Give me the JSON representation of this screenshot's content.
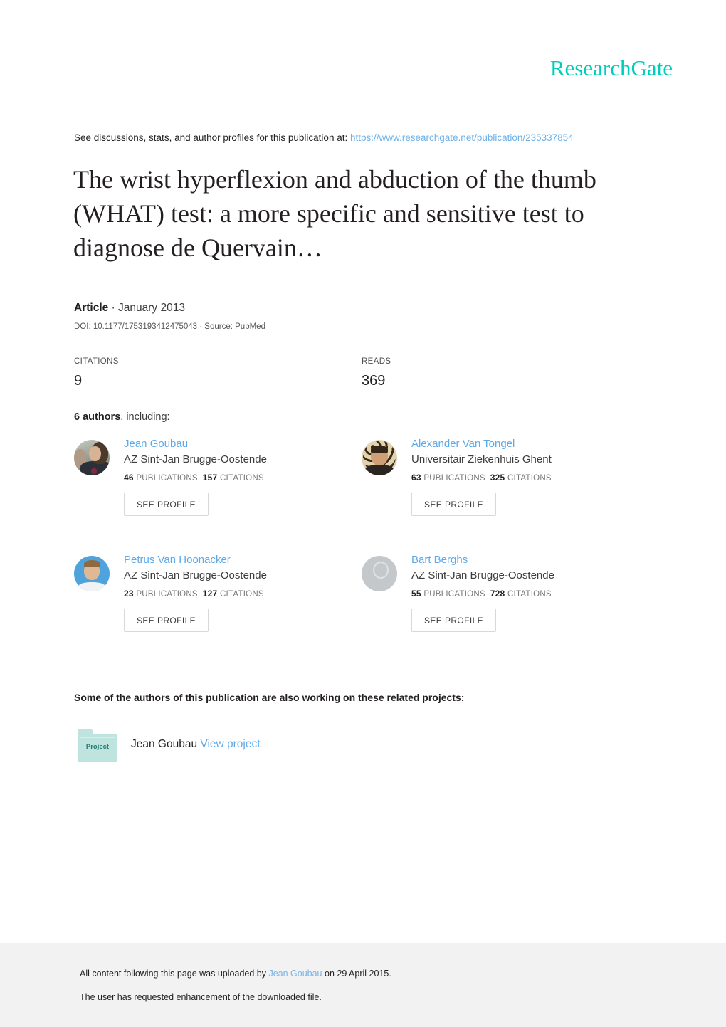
{
  "brand": {
    "logo_text": "ResearchGate",
    "logo_color": "#00CCBB"
  },
  "discussion": {
    "prefix": "See discussions, stats, and author profiles for this publication at:",
    "url": "https://www.researchgate.net/publication/235337854",
    "url_color": "#6EB1E8"
  },
  "publication": {
    "title": "The wrist hyperflexion and abduction of the thumb (WHAT) test: a more specific and sensitive test to diagnose de Quervain…",
    "type": "Article",
    "type_separator": " · ",
    "date": "January 2013",
    "doi_line": "DOI: 10.1177/1753193412475043 · Source: PubMed"
  },
  "stats": {
    "citations": {
      "label": "CITATIONS",
      "value": "9"
    },
    "reads": {
      "label": "READS",
      "value": "369"
    }
  },
  "authors_section": {
    "count_text": "6 authors",
    "suffix_text": ", including:",
    "see_profile_label": "SEE PROFILE",
    "publications_label": "PUBLICATIONS",
    "citations_label": "CITATIONS",
    "authors": [
      {
        "name": "Jean Goubau",
        "institution": "AZ Sint-Jan Brugge-Oostende",
        "publications": "46",
        "citations": "157",
        "avatar": "photo-portrait-male-glasses"
      },
      {
        "name": "Alexander Van Tongel",
        "institution": "Universitair Ziekenhuis Ghent",
        "publications": "63",
        "citations": "325",
        "avatar": "photo-portrait-male-glasses"
      },
      {
        "name": "Petrus Van Hoonacker",
        "institution": "AZ Sint-Jan Brugge-Oostende",
        "publications": "23",
        "citations": "127",
        "avatar": "photo-portrait-male-blue-bg"
      },
      {
        "name": "Bart Berghs",
        "institution": "AZ Sint-Jan Brugge-Oostende",
        "publications": "55",
        "citations": "728",
        "avatar": "placeholder-person-icon"
      }
    ]
  },
  "projects": {
    "heading": "Some of the authors of this publication are also working on these related projects:",
    "folder_label": "Project",
    "owner": "Jean Goubau ",
    "link_label": "View project"
  },
  "footer": {
    "upload_prefix": "All content following this page was uploaded by ",
    "uploader": "Jean Goubau",
    "upload_suffix": " on 29 April 2015.",
    "enhancement_note": "The user has requested enhancement of the downloaded file."
  }
}
